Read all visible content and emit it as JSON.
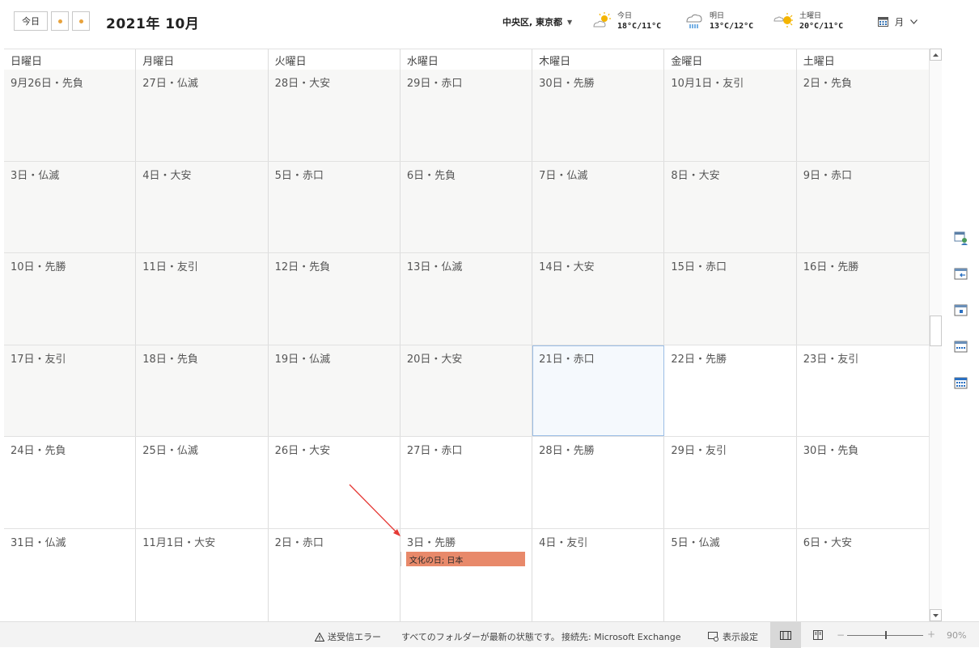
{
  "header": {
    "today_label": "今日",
    "month_title": "2021年 10月",
    "location": "中央区, 東京都",
    "weather": [
      {
        "day": "今日",
        "temp": "18°C/11°C",
        "icon": "sunny-cloudy-icon"
      },
      {
        "day": "明日",
        "temp": "13°C/12°C",
        "icon": "rain-icon"
      },
      {
        "day": "土曜日",
        "temp": "20°C/11°C",
        "icon": "sunny-cloudy-icon"
      }
    ],
    "view_label": "月"
  },
  "weekdays": [
    "日曜日",
    "月曜日",
    "火曜日",
    "水曜日",
    "木曜日",
    "金曜日",
    "土曜日"
  ],
  "weeks": [
    [
      "9月26日・先負",
      "27日・仏滅",
      "28日・大安",
      "29日・赤口",
      "30日・先勝",
      "10月1日・友引",
      "2日・先負"
    ],
    [
      "3日・仏滅",
      "4日・大安",
      "5日・赤口",
      "6日・先負",
      "7日・仏滅",
      "8日・大安",
      "9日・赤口"
    ],
    [
      "10日・先勝",
      "11日・友引",
      "12日・先負",
      "13日・仏滅",
      "14日・大安",
      "15日・赤口",
      "16日・先勝"
    ],
    [
      "17日・友引",
      "18日・先負",
      "19日・仏滅",
      "20日・大安",
      "21日・赤口",
      "22日・先勝",
      "23日・友引"
    ],
    [
      "24日・先負",
      "25日・仏滅",
      "26日・大安",
      "27日・赤口",
      "28日・先勝",
      "29日・友引",
      "30日・先負"
    ],
    [
      "31日・仏滅",
      "11月1日・大安",
      "2日・赤口",
      "3日・先勝",
      "4日・友引",
      "5日・仏滅",
      "6日・大安"
    ]
  ],
  "event": {
    "title": "文化の日; 日本",
    "color": "#e8896a"
  },
  "statusbar": {
    "error": "送受信エラー",
    "folders": "すべてのフォルダーが最新の状態です。",
    "connection": "接続先: Microsoft Exchange",
    "view_settings": "表示設定",
    "zoom": "90%"
  },
  "colors": {
    "accent_dot": "#e8a23c",
    "today_border": "#9bbde5",
    "arrow": "#e53935"
  }
}
